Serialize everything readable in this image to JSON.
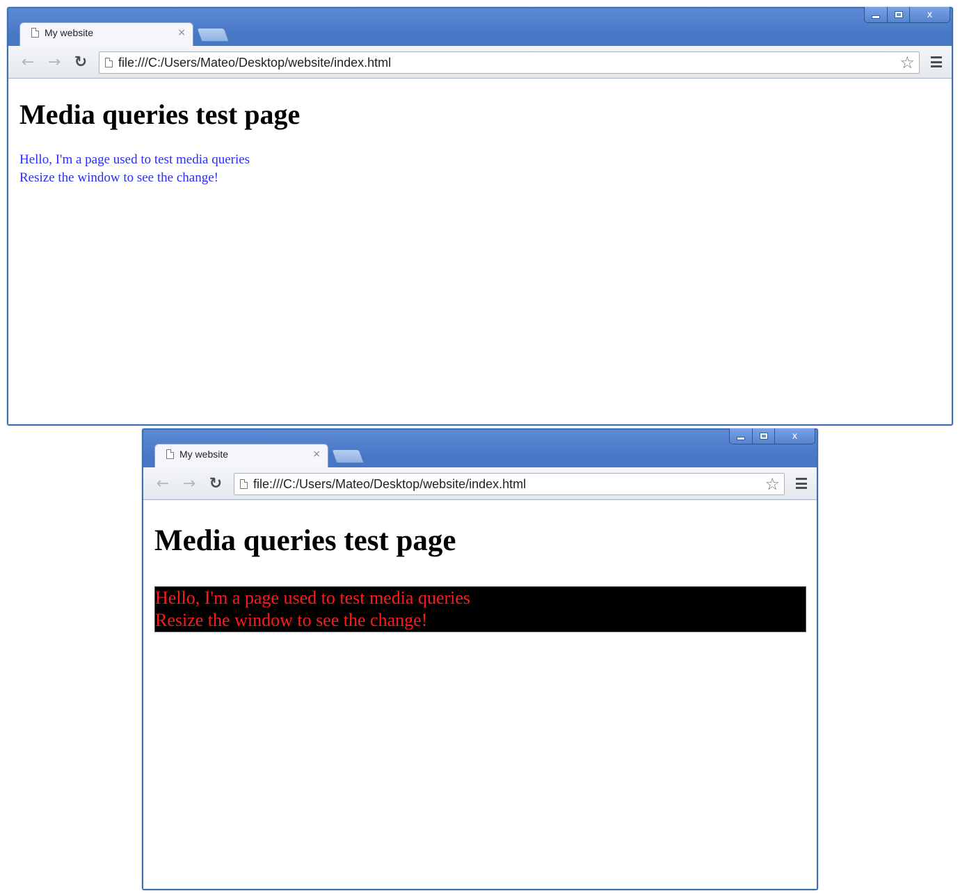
{
  "windows": [
    {
      "tab": {
        "title": "My website",
        "close": "×"
      },
      "controls": {
        "close": "x"
      },
      "address": {
        "url": "file:///C:/Users/Mateo/Desktop/website/index.html"
      },
      "page": {
        "heading": "Media queries test page",
        "lines": [
          "Hello, I'm a page used to test media queries",
          "Resize the window to see the change!"
        ],
        "text_color": "#2b2bff",
        "background": "#ffffff"
      }
    },
    {
      "tab": {
        "title": "My website",
        "close": "×"
      },
      "controls": {
        "close": "x"
      },
      "address": {
        "url": "file:///C:/Users/Mateo/Desktop/website/index.html"
      },
      "page": {
        "heading": "Media queries test page",
        "lines": [
          "Hello, I'm a page used to test media queries",
          "Resize the window to see the change!"
        ],
        "text_color": "#ff1a1a",
        "background": "#000000"
      }
    }
  ],
  "icons": {
    "back": "back-arrow-icon",
    "forward": "forward-arrow-icon",
    "reload": "reload-icon",
    "page": "page-icon",
    "star": "star-icon",
    "menu": "menu-icon"
  },
  "colors": {
    "window_frame": "#4a7cc9",
    "toolbar": "#e5e8ed"
  }
}
